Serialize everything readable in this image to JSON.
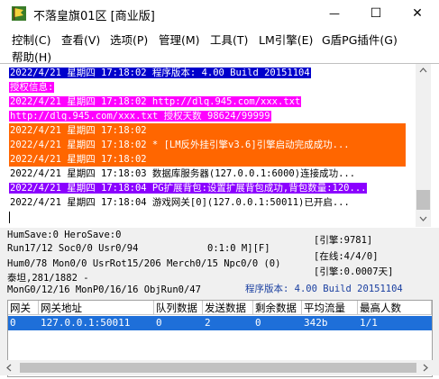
{
  "window": {
    "title": "不落皇旗01区 [商业版]",
    "minimize_glyph": "—",
    "maximize_glyph": "☐",
    "close_glyph": "✕",
    "icon": "flag-icon"
  },
  "menu": [
    "控制(C)",
    "查看(V)",
    "选项(P)",
    "管理(M)",
    "工具(T)",
    "LM引擎(E)",
    "G盾PG插件(G)",
    "帮助(H)"
  ],
  "log": [
    {
      "text": "2022/4/21 星期四 17:18:02 程序版本: 4.00 Build 20151104",
      "fg": "#ffffff",
      "bg": "#0000cc"
    },
    {
      "text": "授权信息:",
      "fg": "#ffffff",
      "bg": "#ff00ff"
    },
    {
      "text": "2022/4/21 星期四 17:18:02 http://dlq.945.com/xxx.txt",
      "fg": "#ffffff",
      "bg": "#ff00ff"
    },
    {
      "text": "http://dlq.945.com/xxx.txt 授权天数 98624/99999",
      "fg": "#ffffff",
      "bg": "#ff00ff"
    },
    {
      "text": "2022/4/21 星期四 17:18:02",
      "fg": "#ffffff",
      "bg": "#ff6600",
      "bar": true
    },
    {
      "text": "2022/4/21 星期四 17:18:02 * [LM反外挂引擎v3.6]引擎启动完成成功...",
      "fg": "#ffffff",
      "bg": "#ff6600",
      "bar": true
    },
    {
      "text": "2022/4/21 星期四 17:18:02",
      "fg": "#ffffff",
      "bg": "#ff6600",
      "bar": true
    },
    {
      "text": "2022/4/21 星期四 17:18:03 数据库服务器(127.0.0.1:6000)连接成功...",
      "fg": "#000000",
      "bg": ""
    },
    {
      "text": "2022/4/21 星期四 17:18:04 PG扩展背包:设置扩展背包成功,背包数量:120...",
      "fg": "#ffffff",
      "bg": "#8b00ff"
    },
    {
      "text": "2022/4/21 星期四 17:18:04 游戏网关[0](127.0.0.1:50011)已开启...",
      "fg": "#000000",
      "bg": ""
    }
  ],
  "status": {
    "line1": "HumSave:0 HeroSave:0",
    "line2": "Run17/12 Soc0/0 Usr0/94",
    "line2b": "0:1:0 M][F]",
    "line3": "Hum0/78 Mon0/0 UsrRot15/206 Merch0/15 Npc0/0 (0)",
    "line4": "泰坦,281/1882 -",
    "line5": "MonG0/12/16 MonP0/16/16 ObjRun0/47",
    "engine": "[引擎:9781]",
    "online": "[在线:4/4/0]",
    "load": "[引擎:0.0007天]",
    "version": "程序版本: 4.00 Build 20151104"
  },
  "grid": {
    "headers": [
      "网关",
      "网关地址",
      "队列数据",
      "发送数据",
      "剩余数据",
      "平均流量",
      "最高人数"
    ],
    "rows": [
      [
        "0",
        "127.0.0.1:50011",
        "0",
        "2",
        "0",
        "342b",
        "1/1"
      ]
    ]
  }
}
